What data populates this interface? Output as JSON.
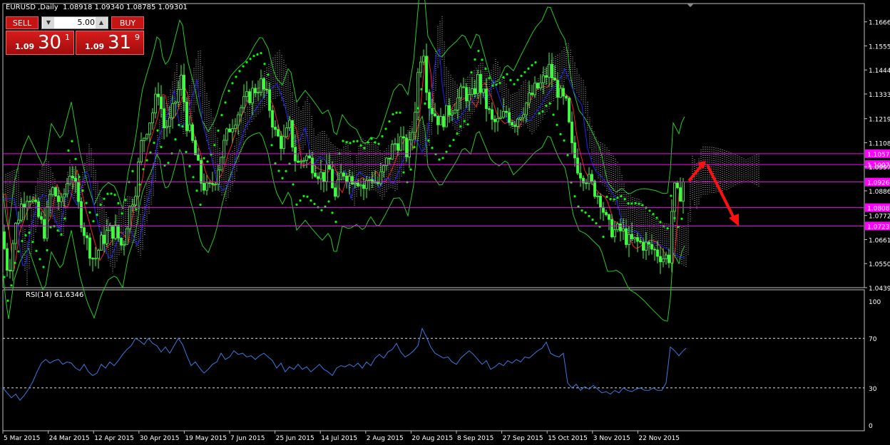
{
  "header": {
    "title": "EURUSD ,Daily  1.08918 1.09340 1.08785 1.09301"
  },
  "trade": {
    "sell_label": "SELL",
    "buy_label": "BUY",
    "quantity": "5.00",
    "sell_prefix": "1.09",
    "sell_big": "30",
    "sell_sup": "1",
    "buy_prefix": "1.09",
    "buy_big": "31",
    "buy_sup": "9"
  },
  "chart_data": [
    {
      "type": "candlestick",
      "symbol": "EURUSD",
      "timeframe": "Daily",
      "ohlc_current": {
        "open": 1.08918,
        "high": 1.0934,
        "low": 1.08785,
        "close": 1.09301
      },
      "ylim": [
        1.0439,
        1.1711
      ],
      "y_ticks": [
        "1.16660",
        "1.15550",
        "1.14440",
        "1.13330",
        "1.12190",
        "1.11080",
        "1.09970",
        "1.08860",
        "1.07720",
        "1.06610",
        "1.05500",
        "1.04390"
      ],
      "x_ticks": [
        "5 Mar 2015",
        "24 Mar 2015",
        "12 Apr 2015",
        "30 Apr 2015",
        "19 May 2015",
        "7 Jun 2015",
        "25 Jun 2015",
        "14 Jul 2015",
        "2 Aug 2015",
        "20 Aug 2015",
        "8 Sep 2015",
        "27 Sep 2015",
        "15 Oct 2015",
        "3 Nov 2015",
        "22 Nov 2015"
      ],
      "horizontal_levels": [
        {
          "label": "1.10575",
          "value": 1.10575
        },
        {
          "label": "1.10073",
          "value": 1.10073
        },
        {
          "label": "1.09265",
          "value": 1.09265
        },
        {
          "label": "1.08083",
          "value": 1.08083
        },
        {
          "label": "1.07237",
          "value": 1.07237
        }
      ],
      "close_path": [
        [
          0,
          1.085
        ],
        [
          6,
          1.062
        ],
        [
          12,
          1.05
        ],
        [
          20,
          1.07
        ],
        [
          30,
          1.082
        ],
        [
          40,
          1.088
        ],
        [
          52,
          1.078
        ],
        [
          62,
          1.07
        ],
        [
          72,
          1.09
        ],
        [
          86,
          1.082
        ],
        [
          100,
          1.1
        ],
        [
          112,
          1.078
        ],
        [
          122,
          1.065
        ],
        [
          132,
          1.056
        ],
        [
          142,
          1.065
        ],
        [
          152,
          1.07
        ],
        [
          162,
          1.07
        ],
        [
          172,
          1.062
        ],
        [
          180,
          1.078
        ],
        [
          190,
          1.09
        ],
        [
          198,
          1.11
        ],
        [
          206,
          1.118
        ],
        [
          214,
          1.125
        ],
        [
          222,
          1.135
        ],
        [
          230,
          1.118
        ],
        [
          238,
          1.12
        ],
        [
          246,
          1.13
        ],
        [
          254,
          1.14
        ],
        [
          262,
          1.12
        ],
        [
          272,
          1.108
        ],
        [
          282,
          1.093
        ],
        [
          292,
          1.088
        ],
        [
          302,
          1.095
        ],
        [
          312,
          1.108
        ],
        [
          322,
          1.118
        ],
        [
          334,
          1.125
        ],
        [
          344,
          1.13
        ],
        [
          356,
          1.135
        ],
        [
          366,
          1.138
        ],
        [
          376,
          1.13
        ],
        [
          386,
          1.115
        ],
        [
          396,
          1.11
        ],
        [
          406,
          1.118
        ],
        [
          416,
          1.1
        ],
        [
          428,
          1.105
        ],
        [
          440,
          1.1
        ],
        [
          452,
          1.095
        ],
        [
          462,
          1.098
        ],
        [
          470,
          1.085
        ],
        [
          480,
          1.098
        ],
        [
          490,
          1.095
        ],
        [
          500,
          1.095
        ],
        [
          510,
          1.09
        ],
        [
          520,
          1.095
        ],
        [
          530,
          1.092
        ],
        [
          540,
          1.1
        ],
        [
          552,
          1.11
        ],
        [
          562,
          1.112
        ],
        [
          572,
          1.105
        ],
        [
          580,
          1.12
        ],
        [
          588,
          1.15
        ],
        [
          594,
          1.154
        ],
        [
          600,
          1.13
        ],
        [
          608,
          1.125
        ],
        [
          618,
          1.12
        ],
        [
          628,
          1.125
        ],
        [
          640,
          1.13
        ],
        [
          650,
          1.135
        ],
        [
          660,
          1.13
        ],
        [
          670,
          1.14
        ],
        [
          680,
          1.13
        ],
        [
          690,
          1.12
        ],
        [
          700,
          1.12
        ],
        [
          710,
          1.125
        ],
        [
          720,
          1.12
        ],
        [
          730,
          1.125
        ],
        [
          740,
          1.13
        ],
        [
          750,
          1.135
        ],
        [
          760,
          1.138
        ],
        [
          770,
          1.145
        ],
        [
          778,
          1.138
        ],
        [
          786,
          1.132
        ],
        [
          794,
          1.128
        ],
        [
          802,
          1.108
        ],
        [
          812,
          1.098
        ],
        [
          822,
          1.095
        ],
        [
          832,
          1.09
        ],
        [
          842,
          1.085
        ],
        [
          852,
          1.072
        ],
        [
          862,
          1.07
        ],
        [
          872,
          1.07
        ],
        [
          882,
          1.065
        ],
        [
          892,
          1.065
        ],
        [
          902,
          1.064
        ],
        [
          912,
          1.062
        ],
        [
          922,
          1.06
        ],
        [
          930,
          1.058
        ],
        [
          938,
          1.058
        ],
        [
          944,
          1.09
        ],
        [
          952,
          1.085
        ],
        [
          958,
          1.093
        ]
      ],
      "annotation": {
        "type": "arrow",
        "color": "#ff1010"
      }
    },
    {
      "type": "line",
      "title": "RSI(14) 61.6346",
      "ylim": [
        0,
        100
      ],
      "y_ticks": [
        "100",
        "70",
        "30",
        "0"
      ],
      "levels": [
        70,
        30
      ],
      "last_value": 61.6346,
      "values_path": [
        [
          4,
          30
        ],
        [
          10,
          26
        ],
        [
          16,
          22
        ],
        [
          22,
          25
        ],
        [
          28,
          20
        ],
        [
          34,
          24
        ],
        [
          40,
          29
        ],
        [
          46,
          35
        ],
        [
          52,
          43
        ],
        [
          58,
          50
        ],
        [
          64,
          53
        ],
        [
          70,
          50
        ],
        [
          76,
          52
        ],
        [
          82,
          53
        ],
        [
          88,
          49
        ],
        [
          94,
          51
        ],
        [
          100,
          50
        ],
        [
          106,
          46
        ],
        [
          112,
          44
        ],
        [
          118,
          49
        ],
        [
          124,
          43
        ],
        [
          130,
          40
        ],
        [
          136,
          42
        ],
        [
          142,
          49
        ],
        [
          148,
          46
        ],
        [
          154,
          51
        ],
        [
          160,
          48
        ],
        [
          166,
          52
        ],
        [
          172,
          57
        ],
        [
          178,
          61
        ],
        [
          184,
          64
        ],
        [
          190,
          70
        ],
        [
          196,
          68
        ],
        [
          202,
          65
        ],
        [
          208,
          70
        ],
        [
          214,
          66
        ],
        [
          220,
          64
        ],
        [
          226,
          59
        ],
        [
          232,
          63
        ],
        [
          238,
          58
        ],
        [
          244,
          64
        ],
        [
          250,
          70
        ],
        [
          256,
          65
        ],
        [
          262,
          56
        ],
        [
          268,
          48
        ],
        [
          274,
          51
        ],
        [
          280,
          46
        ],
        [
          286,
          42
        ],
        [
          292,
          45
        ],
        [
          298,
          49
        ],
        [
          304,
          51
        ],
        [
          310,
          58
        ],
        [
          316,
          53
        ],
        [
          322,
          55
        ],
        [
          328,
          60
        ],
        [
          334,
          57
        ],
        [
          340,
          58
        ],
        [
          346,
          55
        ],
        [
          352,
          56
        ],
        [
          358,
          53
        ],
        [
          364,
          56
        ],
        [
          370,
          58
        ],
        [
          376,
          55
        ],
        [
          382,
          52
        ],
        [
          388,
          46
        ],
        [
          394,
          50
        ],
        [
          400,
          43
        ],
        [
          406,
          47
        ],
        [
          412,
          45
        ],
        [
          418,
          49
        ],
        [
          424,
          45
        ],
        [
          430,
          47
        ],
        [
          436,
          43
        ],
        [
          442,
          46
        ],
        [
          448,
          49
        ],
        [
          454,
          45
        ],
        [
          460,
          43
        ],
        [
          466,
          40
        ],
        [
          472,
          46
        ],
        [
          478,
          48
        ],
        [
          484,
          47
        ],
        [
          490,
          49
        ],
        [
          496,
          47
        ],
        [
          502,
          50
        ],
        [
          508,
          46
        ],
        [
          514,
          51
        ],
        [
          520,
          48
        ],
        [
          526,
          54
        ],
        [
          532,
          57
        ],
        [
          538,
          54
        ],
        [
          544,
          59
        ],
        [
          550,
          61
        ],
        [
          556,
          66
        ],
        [
          562,
          59
        ],
        [
          568,
          55
        ],
        [
          574,
          57
        ],
        [
          580,
          60
        ],
        [
          586,
          64
        ],
        [
          592,
          78
        ],
        [
          598,
          71
        ],
        [
          604,
          63
        ],
        [
          610,
          58
        ],
        [
          616,
          56
        ],
        [
          622,
          54
        ],
        [
          628,
          55
        ],
        [
          634,
          51
        ],
        [
          640,
          49
        ],
        [
          646,
          54
        ],
        [
          652,
          57
        ],
        [
          658,
          60
        ],
        [
          664,
          57
        ],
        [
          670,
          53
        ],
        [
          676,
          49
        ],
        [
          682,
          52
        ],
        [
          688,
          45
        ],
        [
          694,
          47
        ],
        [
          700,
          50
        ],
        [
          706,
          48
        ],
        [
          712,
          52
        ],
        [
          718,
          50
        ],
        [
          724,
          53
        ],
        [
          730,
          51
        ],
        [
          736,
          55
        ],
        [
          742,
          54
        ],
        [
          748,
          57
        ],
        [
          754,
          60
        ],
        [
          760,
          62
        ],
        [
          766,
          67
        ],
        [
          772,
          58
        ],
        [
          778,
          56
        ],
        [
          784,
          55
        ],
        [
          790,
          58
        ],
        [
          796,
          34
        ],
        [
          802,
          30
        ],
        [
          808,
          33
        ],
        [
          814,
          28
        ],
        [
          820,
          31
        ],
        [
          826,
          29
        ],
        [
          832,
          32
        ],
        [
          838,
          29
        ],
        [
          844,
          26
        ],
        [
          850,
          27
        ],
        [
          856,
          25
        ],
        [
          862,
          28
        ],
        [
          868,
          26
        ],
        [
          874,
          30
        ],
        [
          880,
          28
        ],
        [
          886,
          27
        ],
        [
          892,
          29
        ],
        [
          898,
          30
        ],
        [
          904,
          28
        ],
        [
          910,
          28
        ],
        [
          916,
          30
        ],
        [
          922,
          28
        ],
        [
          928,
          28
        ],
        [
          934,
          34
        ],
        [
          940,
          63
        ],
        [
          946,
          60
        ],
        [
          952,
          56
        ],
        [
          958,
          60
        ],
        [
          962,
          62
        ]
      ]
    }
  ],
  "colors": {
    "candle": "#40ff40",
    "bands": "#22cc22",
    "ma_red": "#ff2020",
    "ma_blue": "#2222ff",
    "sar": "#00ff00",
    "cloud": "#ffffff",
    "level": "#ff00ff",
    "rsi": "#3a79e0",
    "arrow": "#ff1010"
  }
}
